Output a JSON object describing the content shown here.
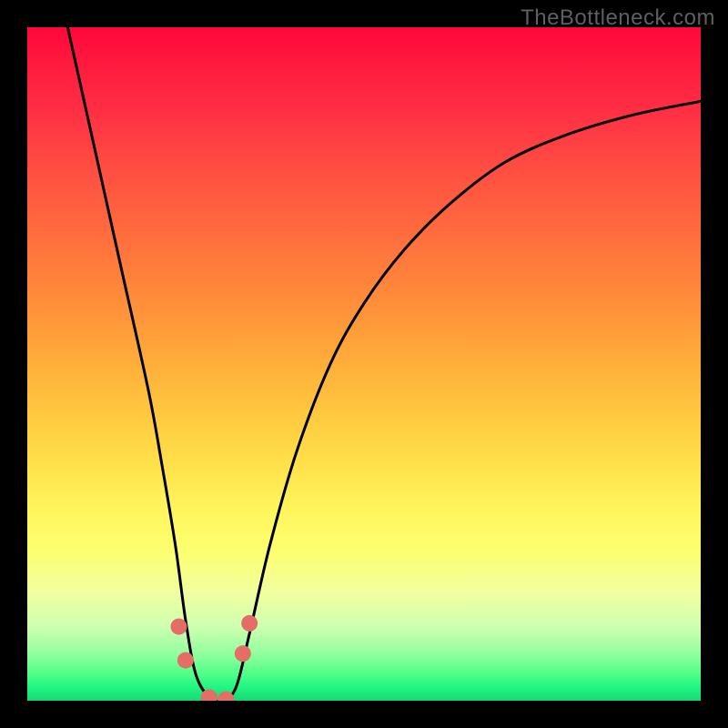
{
  "watermark": "TheBottleneck.com",
  "chart_data": {
    "type": "line",
    "title": "",
    "xlabel": "",
    "ylabel": "",
    "xlim": [
      0,
      100
    ],
    "ylim": [
      0,
      100
    ],
    "series": [
      {
        "name": "bottleneck-curve",
        "x": [
          6,
          10,
          14,
          18,
          20,
          22,
          23.5,
          25,
          27,
          29,
          31,
          33,
          36,
          40,
          45,
          50,
          56,
          63,
          71,
          80,
          90,
          100
        ],
        "values": [
          100,
          82,
          64,
          46,
          35,
          23,
          12,
          4,
          0.5,
          0,
          2,
          10,
          23,
          37,
          50,
          59,
          67,
          74,
          80,
          84,
          87,
          89
        ]
      }
    ],
    "markers": [
      {
        "name": "marker-left-upper",
        "x": 22.5,
        "y": 11.0
      },
      {
        "name": "marker-left-lower",
        "x": 23.5,
        "y": 6.0
      },
      {
        "name": "marker-bottom-left",
        "x": 27.0,
        "y": 0.5
      },
      {
        "name": "marker-bottom-right",
        "x": 29.5,
        "y": 0.2
      },
      {
        "name": "marker-right-lower",
        "x": 32.0,
        "y": 7.0
      },
      {
        "name": "marker-right-upper",
        "x": 33.0,
        "y": 11.5
      }
    ],
    "gradient_stops": [
      {
        "pct": 0,
        "color": "#ff073a"
      },
      {
        "pct": 20,
        "color": "#ff4a42"
      },
      {
        "pct": 40,
        "color": "#ff8b3a"
      },
      {
        "pct": 58,
        "color": "#ffca3f"
      },
      {
        "pct": 72,
        "color": "#fff65e"
      },
      {
        "pct": 86,
        "color": "#e0ffa8"
      },
      {
        "pct": 95,
        "color": "#70ff94"
      },
      {
        "pct": 100,
        "color": "#18d86f"
      }
    ],
    "marker_style": {
      "color": "#e46e66",
      "radius_px": 9
    }
  }
}
